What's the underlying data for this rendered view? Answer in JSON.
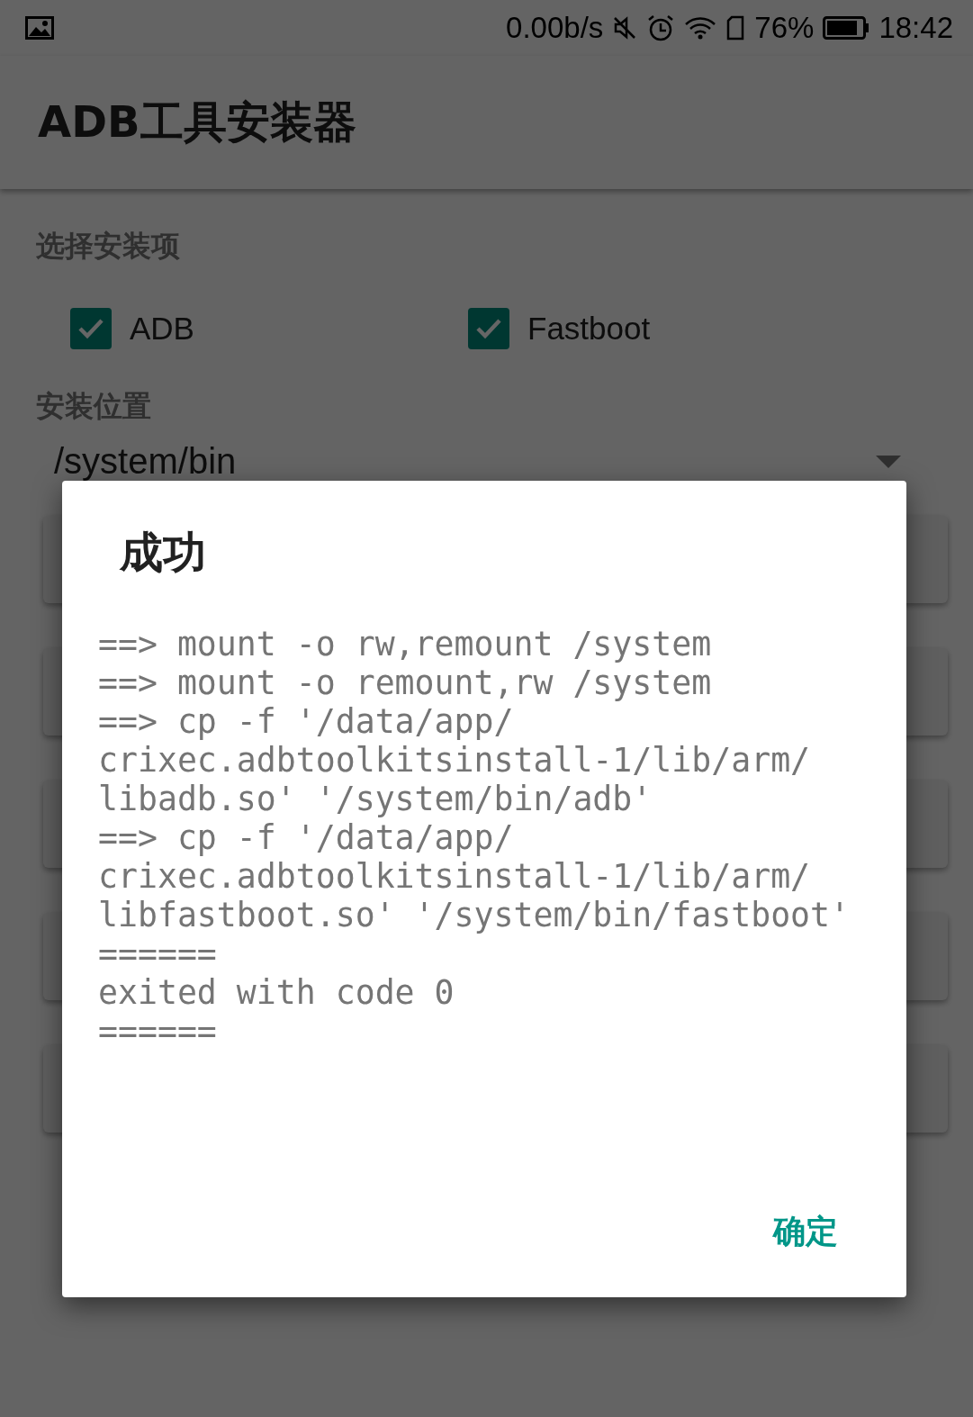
{
  "status_bar": {
    "network_speed": "0.00b/s",
    "battery_percent": "76%",
    "time": "18:42"
  },
  "app_bar": {
    "title": "ADB工具安装器"
  },
  "install_items": {
    "label": "选择安装项",
    "options": [
      {
        "label": "ADB",
        "checked": true
      },
      {
        "label": "Fastboot",
        "checked": true
      }
    ]
  },
  "install_location": {
    "label": "安装位置",
    "value": "/system/bin"
  },
  "hidden_buttons_count_rows": [
    {},
    {},
    {},
    {},
    {}
  ],
  "dialog": {
    "title": "成功",
    "log_lines": [
      "==> mount -o rw,remount /system",
      "==> mount -o remount,rw /system",
      "==> cp -f '/data/app/",
      "crixec.adbtoolkitsinstall-1/lib/arm/",
      "libadb.so' '/system/bin/adb'",
      "==> cp -f '/data/app/",
      "crixec.adbtoolkitsinstall-1/lib/arm/",
      "libfastboot.so' '/system/bin/fastboot'",
      "======",
      "exited with code 0",
      "======"
    ],
    "button": "确定"
  }
}
